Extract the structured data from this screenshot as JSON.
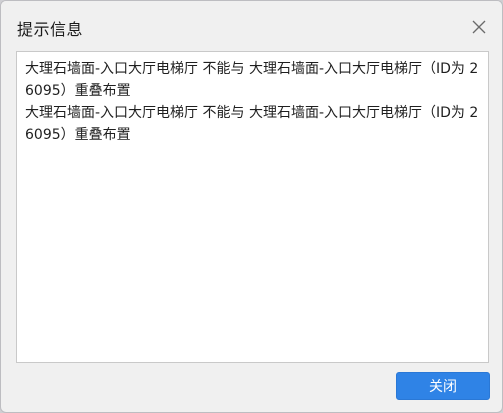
{
  "dialog": {
    "title": "提示信息",
    "close_icon": "close-icon",
    "messages": [
      "大理石墙面-入口大厅电梯厅 不能与 大理石墙面-入口大厅电梯厅（ID为 26095）重叠布置",
      "大理石墙面-入口大厅电梯厅 不能与 大理石墙面-入口大厅电梯厅（ID为 26095）重叠布置"
    ],
    "close_button_label": "关闭",
    "accent_color": "#2f83e6"
  }
}
